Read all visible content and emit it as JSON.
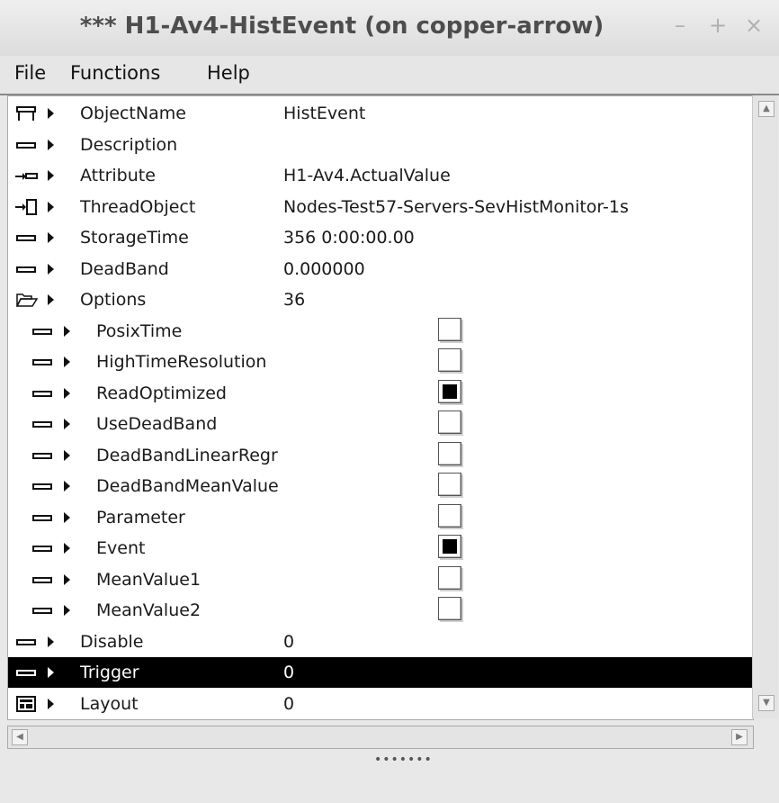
{
  "window": {
    "title": "*** H1-Av4-HistEvent (on copper-arrow)",
    "min_label": "–",
    "max_label": "+",
    "close_label": "×"
  },
  "menubar": {
    "items": [
      {
        "label": "File"
      },
      {
        "label": "Functions"
      },
      {
        "label": "Help"
      }
    ]
  },
  "tree": {
    "rows": [
      {
        "icon": "object-icon",
        "name": "ObjectName",
        "value": "HistEvent"
      },
      {
        "icon": "attribute-icon",
        "name": "Description",
        "value": ""
      },
      {
        "icon": "attrref-icon",
        "name": "Attribute",
        "value": "H1-Av4.ActualValue"
      },
      {
        "icon": "objref-icon",
        "name": "ThreadObject",
        "value": "Nodes-Test57-Servers-SevHistMonitor-1s"
      },
      {
        "icon": "attribute-icon",
        "name": "StorageTime",
        "value": "356 0:00:00.00"
      },
      {
        "icon": "attribute-icon",
        "name": "DeadBand",
        "value": "0.000000"
      },
      {
        "icon": "folder-open-icon",
        "name": "Options",
        "value": "36"
      },
      {
        "icon": "attribute-icon",
        "name": "PosixTime",
        "checked": false
      },
      {
        "icon": "attribute-icon",
        "name": "HighTimeResolution",
        "checked": false
      },
      {
        "icon": "attribute-icon",
        "name": "ReadOptimized",
        "checked": true
      },
      {
        "icon": "attribute-icon",
        "name": "UseDeadBand",
        "checked": false
      },
      {
        "icon": "attribute-icon",
        "name": "DeadBandLinearRegr",
        "checked": false
      },
      {
        "icon": "attribute-icon",
        "name": "DeadBandMeanValue",
        "checked": false
      },
      {
        "icon": "attribute-icon",
        "name": "Parameter",
        "checked": false
      },
      {
        "icon": "attribute-icon",
        "name": "Event",
        "checked": true
      },
      {
        "icon": "attribute-icon",
        "name": "MeanValue1",
        "checked": false
      },
      {
        "icon": "attribute-icon",
        "name": "MeanValue2",
        "checked": false
      },
      {
        "icon": "attribute-icon",
        "name": "Disable",
        "value": "0"
      },
      {
        "icon": "attribute-icon",
        "name": "Trigger",
        "value": "0",
        "selected": true
      },
      {
        "icon": "layout-icon",
        "name": "Layout",
        "value": "0"
      }
    ]
  },
  "colors": {
    "selection_bg": "#000000",
    "selection_fg": "#ffffff",
    "tree_bg": "#ffffff"
  }
}
